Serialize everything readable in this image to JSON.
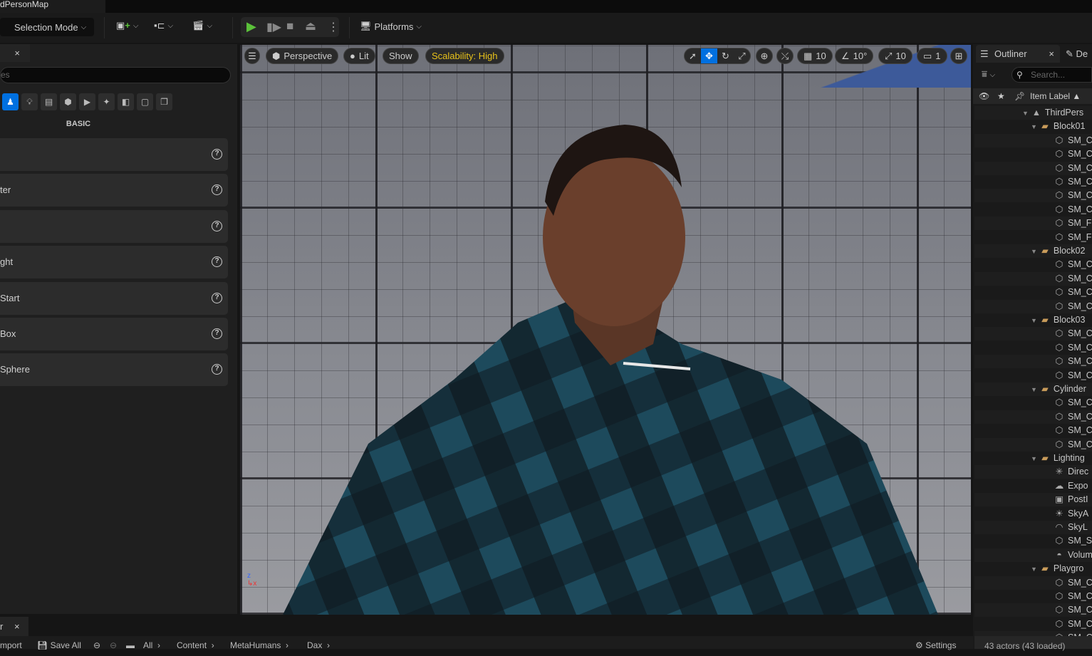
{
  "window": {
    "map_tab": "dPersonMap"
  },
  "toolbar": {
    "selection_mode": "Selection Mode",
    "platforms": "Platforms",
    "icons": [
      "add-actor-icon",
      "blueprint-icon",
      "cinematics-icon",
      "play-icon",
      "advance-frame-icon",
      "stop-icon",
      "eject-icon",
      "more-options-icon",
      "platforms-icon"
    ]
  },
  "left_panel": {
    "close": "×",
    "search_placeholder": "es",
    "category_label": "BASIC",
    "categories": [
      "basic-icon",
      "lights-icon",
      "cinematic-icon",
      "visual-effects-icon",
      "volumes-icon",
      "all-classes-icon",
      "geometry-icon",
      "shapes-icon",
      "place-more-icon"
    ],
    "items": [
      {
        "label": ""
      },
      {
        "label": "ter"
      },
      {
        "label": ""
      },
      {
        "label": "ght"
      },
      {
        "label": "Start"
      },
      {
        "label": "Box"
      },
      {
        "label": "Sphere"
      }
    ]
  },
  "viewport": {
    "perspective": "Perspective",
    "lit": "Lit",
    "show": "Show",
    "scalability": "Scalability: High",
    "grid_snap": "10",
    "rotation_snap": "10°",
    "scale_snap": "10",
    "camera_speed": "1",
    "accent": "#0070e0",
    "scalability_color": "#e8c21a"
  },
  "outliner": {
    "tab": "Outliner",
    "close": "×",
    "details_tab": "De",
    "search_placeholder": "Search...",
    "column": "Item Label ▲",
    "rows": [
      {
        "label": "ThirdPers",
        "type": "world",
        "depth": 0
      },
      {
        "label": "Block01",
        "type": "folder",
        "depth": 1
      },
      {
        "label": "SM_C",
        "type": "mesh",
        "depth": 2
      },
      {
        "label": "SM_C",
        "type": "mesh",
        "depth": 2
      },
      {
        "label": "SM_C",
        "type": "mesh",
        "depth": 2
      },
      {
        "label": "SM_C",
        "type": "mesh",
        "depth": 2
      },
      {
        "label": "SM_C",
        "type": "mesh",
        "depth": 2
      },
      {
        "label": "SM_C",
        "type": "mesh",
        "depth": 2
      },
      {
        "label": "SM_F",
        "type": "mesh",
        "depth": 2
      },
      {
        "label": "SM_F",
        "type": "mesh",
        "depth": 2
      },
      {
        "label": "Block02",
        "type": "folder",
        "depth": 1
      },
      {
        "label": "SM_C",
        "type": "mesh",
        "depth": 2
      },
      {
        "label": "SM_C",
        "type": "mesh",
        "depth": 2
      },
      {
        "label": "SM_C",
        "type": "mesh",
        "depth": 2
      },
      {
        "label": "SM_C",
        "type": "mesh",
        "depth": 2
      },
      {
        "label": "Block03",
        "type": "folder",
        "depth": 1
      },
      {
        "label": "SM_C",
        "type": "mesh",
        "depth": 2
      },
      {
        "label": "SM_C",
        "type": "mesh",
        "depth": 2
      },
      {
        "label": "SM_C",
        "type": "mesh",
        "depth": 2
      },
      {
        "label": "SM_C",
        "type": "mesh",
        "depth": 2
      },
      {
        "label": "Cylinder",
        "type": "folder",
        "depth": 1
      },
      {
        "label": "SM_C",
        "type": "mesh",
        "depth": 2
      },
      {
        "label": "SM_C",
        "type": "mesh",
        "depth": 2
      },
      {
        "label": "SM_C",
        "type": "mesh",
        "depth": 2
      },
      {
        "label": "SM_C",
        "type": "mesh",
        "depth": 2
      },
      {
        "label": "Lighting",
        "type": "folder",
        "depth": 1
      },
      {
        "label": "Direc",
        "type": "directional-light",
        "depth": 2
      },
      {
        "label": "Expo",
        "type": "fog",
        "depth": 2
      },
      {
        "label": "PostI",
        "type": "post-process",
        "depth": 2
      },
      {
        "label": "SkyA",
        "type": "sky-atmosphere",
        "depth": 2
      },
      {
        "label": "SkyL",
        "type": "sky-light",
        "depth": 2
      },
      {
        "label": "SM_S",
        "type": "mesh",
        "depth": 2
      },
      {
        "label": "Volum",
        "type": "cloud",
        "depth": 2
      },
      {
        "label": "Playgro",
        "type": "folder",
        "depth": 1
      },
      {
        "label": "SM_C",
        "type": "mesh",
        "depth": 2
      },
      {
        "label": "SM_C",
        "type": "mesh",
        "depth": 2
      },
      {
        "label": "SM_C",
        "type": "mesh",
        "depth": 2
      },
      {
        "label": "SM_C",
        "type": "mesh",
        "depth": 2
      },
      {
        "label": "SM_C",
        "type": "mesh",
        "depth": 2
      }
    ],
    "status": "43 actors (43 loaded)"
  },
  "content_browser": {
    "tab": "r",
    "close": "×",
    "import": "mport",
    "save_all": "Save All",
    "breadcrumbs": [
      "All",
      "Content",
      "MetaHumans",
      "Dax"
    ],
    "settings": "Settings"
  }
}
